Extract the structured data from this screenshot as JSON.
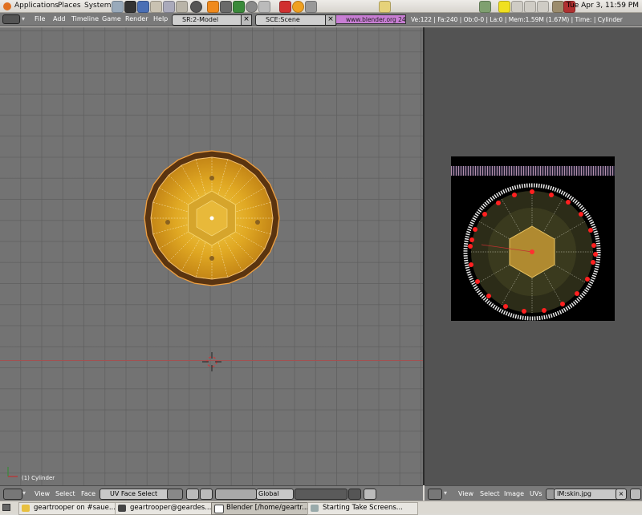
{
  "panel": {
    "menus": [
      "Applications",
      "Places",
      "System"
    ],
    "clock": "Tue Apr  3, 11:59 PM"
  },
  "blender": {
    "menus": [
      "File",
      "Add",
      "Timeline",
      "Game",
      "Render",
      "Help"
    ],
    "screen": "SR:2-Model",
    "scene": "SCE:Scene",
    "url": "www.blender.org 243",
    "stats": "Ve:122 | Fa:240 | Ob:0-0 | La:0  | Mem:1.59M (1.67M)  | Time: | Cylinder"
  },
  "viewport": {
    "object_label": "(1) Cylinder",
    "menus": [
      "View",
      "Select",
      "Face"
    ],
    "mode": "UV Face Select",
    "orientation": "Global"
  },
  "image_editor": {
    "menus": [
      "View",
      "Select",
      "Image",
      "UVs"
    ],
    "image_name": "IM:skin.jpg"
  },
  "taskbar": {
    "items": [
      "geartrooper on #saue...",
      "geartrooper@geardes...",
      "Blender [/home/geartr...",
      "Starting Take Screens..."
    ]
  },
  "colors": {
    "viewport_bg": "#737373",
    "gold": "#d9a321",
    "uv_vertex": "#ff2020",
    "web_button": "#c87ed4"
  }
}
